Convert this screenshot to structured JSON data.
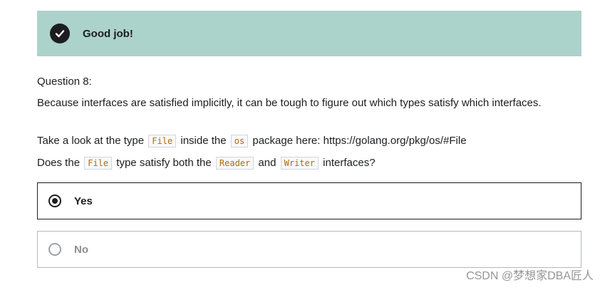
{
  "banner": {
    "message": "Good job!",
    "color": "#acd2cc",
    "icon": "check-circle-icon"
  },
  "question": {
    "number": "Question 8:",
    "line1": "Because interfaces are satisfied implicitly, it can be tough to figure out which types satisfy which interfaces.",
    "line2_part1": "Take a look at the type",
    "line2_code1": "File",
    "line2_part2": "inside the",
    "line2_code2": "os",
    "line2_part3": "package here: https://golang.org/pkg/os/#File",
    "line3_part1": "Does the",
    "line3_code1": "File",
    "line3_part2": "type satisfy both the",
    "line3_code2": "Reader",
    "line3_part3": "and",
    "line3_code3": "Writer",
    "line3_part4": "interfaces?"
  },
  "options": [
    {
      "label": "Yes",
      "selected": true
    },
    {
      "label": "No",
      "selected": false
    }
  ],
  "watermark": "CSDN @梦想家DBA匠人"
}
